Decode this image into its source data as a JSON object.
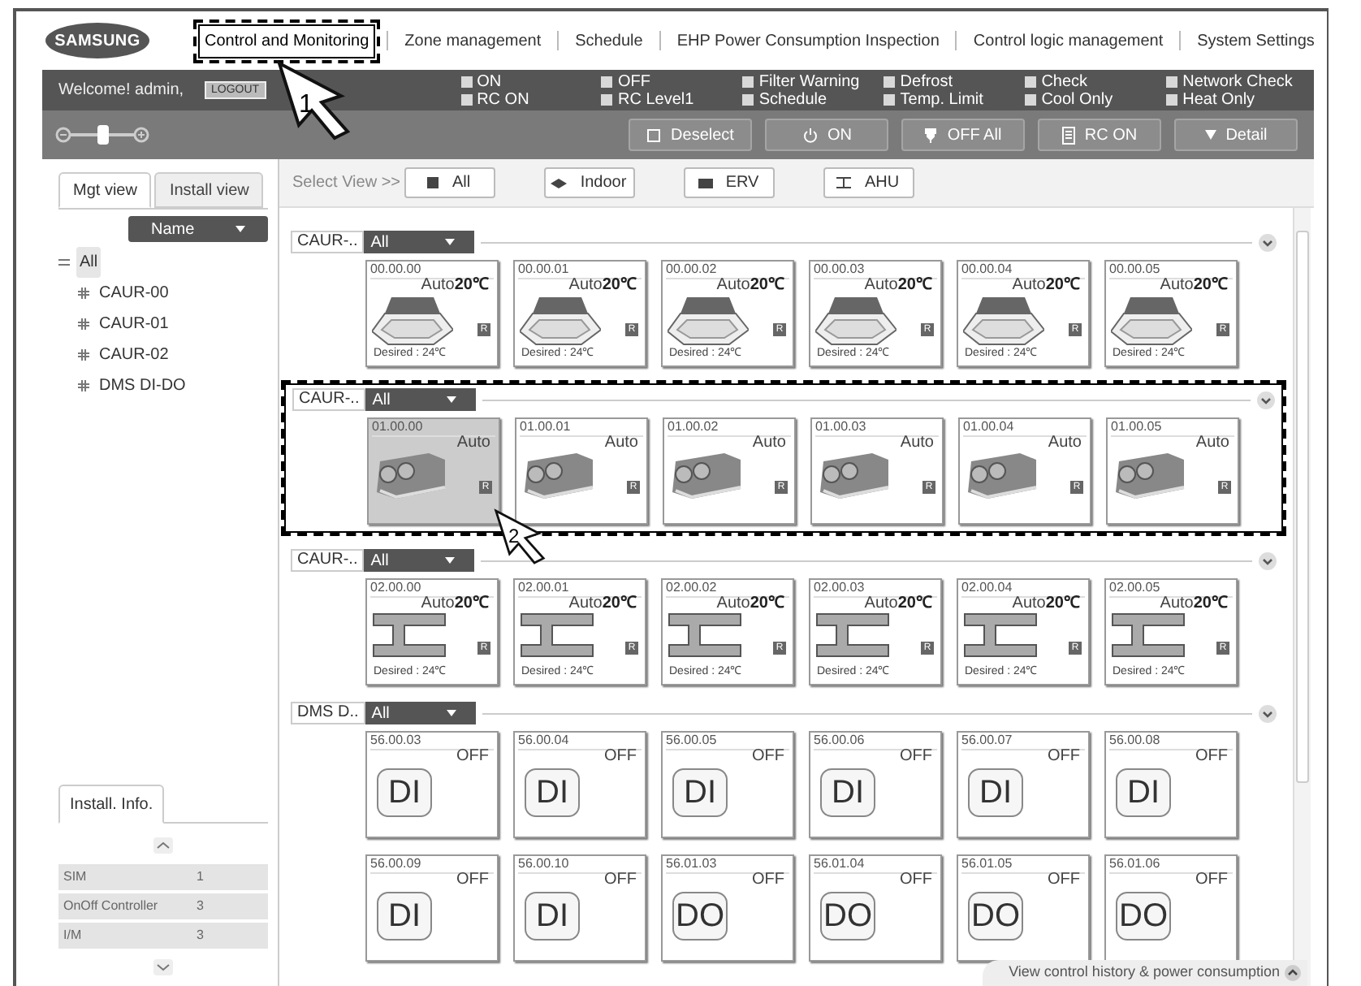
{
  "logo": "SAMSUNG",
  "nav": [
    {
      "label": "Control and Monitoring",
      "selected": true,
      "highlighted": true,
      "callout": "1"
    },
    {
      "label": "Zone management",
      "selected": false,
      "highlighted": false
    },
    {
      "label": "Schedule",
      "selected": false,
      "highlighted": false
    },
    {
      "label": "EHP Power Consumption Inspection",
      "selected": false,
      "highlighted": false
    },
    {
      "label": "Control logic management",
      "selected": false,
      "highlighted": false
    },
    {
      "label": "System Settings",
      "selected": false,
      "highlighted": false
    }
  ],
  "welcome": "Welcome! admin,",
  "logout": "LOGOUT",
  "legend": [
    {
      "label": "ON"
    },
    {
      "label": "OFF"
    },
    {
      "label": "Filter Warning"
    },
    {
      "label": "Defrost"
    },
    {
      "label": "Check"
    },
    {
      "label": "Network Check"
    },
    {
      "label": "RC ON"
    },
    {
      "label": "RC Level1"
    },
    {
      "label": "Schedule"
    },
    {
      "label": "Temp. Limit"
    },
    {
      "label": "Cool Only"
    },
    {
      "label": "Heat Only"
    }
  ],
  "zoom_slider": {
    "level": 0.5
  },
  "toolbar": [
    {
      "kind": "deselect",
      "label": "Deselect"
    },
    {
      "kind": "power",
      "label": "ON"
    },
    {
      "kind": "plug",
      "label": "OFF All"
    },
    {
      "kind": "remote",
      "label": "RC ON"
    },
    {
      "kind": "detail",
      "label": "Detail"
    }
  ],
  "left_tabs": [
    {
      "label": "Mgt view",
      "selected": true
    },
    {
      "label": "Install view",
      "selected": false
    }
  ],
  "sort": "Name",
  "tree": [
    {
      "label": "All",
      "expanded": true,
      "selected": true,
      "children": [
        {
          "label": "CAUR-00",
          "expanded": false,
          "selected": false
        },
        {
          "label": "CAUR-01",
          "expanded": false,
          "selected": false
        },
        {
          "label": "CAUR-02",
          "expanded": false,
          "selected": false
        },
        {
          "label": "DMS DI-DO",
          "expanded": false,
          "selected": false
        }
      ]
    }
  ],
  "install_info": {
    "tab": "Install. Info.",
    "rows": [
      {
        "name": "SIM",
        "count": "1"
      },
      {
        "name": "OnOff Controller",
        "count": "3"
      },
      {
        "name": "I/M",
        "count": "3"
      }
    ]
  },
  "view_label": "Select View >>",
  "view_filters": [
    {
      "kind": "all",
      "label": "All"
    },
    {
      "kind": "indoor",
      "label": "Indoor"
    },
    {
      "kind": "erv",
      "label": "ERV"
    },
    {
      "kind": "ahu",
      "label": "AHU"
    }
  ],
  "groups": [
    {
      "name": "CAUR-..",
      "filter": "All",
      "highlighted": false,
      "tiles": [
        {
          "kind": "cassette",
          "address": "00.00.00",
          "mode": "Auto",
          "temp": "20℃",
          "badge": "R",
          "desired": "Desired : 24℃",
          "selected": false
        },
        {
          "kind": "cassette",
          "address": "00.00.01",
          "mode": "Auto",
          "temp": "20℃",
          "badge": "R",
          "desired": "Desired : 24℃",
          "selected": false
        },
        {
          "kind": "cassette",
          "address": "00.00.02",
          "mode": "Auto",
          "temp": "20℃",
          "badge": "R",
          "desired": "Desired : 24℃",
          "selected": false
        },
        {
          "kind": "cassette",
          "address": "00.00.03",
          "mode": "Auto",
          "temp": "20℃",
          "badge": "R",
          "desired": "Desired : 24℃",
          "selected": false
        },
        {
          "kind": "cassette",
          "address": "00.00.04",
          "mode": "Auto",
          "temp": "20℃",
          "badge": "R",
          "desired": "Desired : 24℃",
          "selected": false
        },
        {
          "kind": "cassette",
          "address": "00.00.05",
          "mode": "Auto",
          "temp": "20℃",
          "badge": "R",
          "desired": "Desired : 24℃",
          "selected": false
        }
      ]
    },
    {
      "name": "CAUR-..",
      "filter": "All",
      "highlighted": true,
      "callout": "2",
      "tiles": [
        {
          "kind": "erv",
          "address": "01.00.00",
          "mode": "Auto",
          "badge": "R",
          "selected": true
        },
        {
          "kind": "erv",
          "address": "01.00.01",
          "mode": "Auto",
          "badge": "R",
          "selected": false
        },
        {
          "kind": "erv",
          "address": "01.00.02",
          "mode": "Auto",
          "badge": "R",
          "selected": false
        },
        {
          "kind": "erv",
          "address": "01.00.03",
          "mode": "Auto",
          "badge": "R",
          "selected": false
        },
        {
          "kind": "erv",
          "address": "01.00.04",
          "mode": "Auto",
          "badge": "R",
          "selected": false
        },
        {
          "kind": "erv",
          "address": "01.00.05",
          "mode": "Auto",
          "badge": "R",
          "selected": false
        }
      ]
    },
    {
      "name": "CAUR-..",
      "filter": "All",
      "highlighted": false,
      "tiles": [
        {
          "kind": "ahu",
          "address": "02.00.00",
          "mode": "Auto",
          "temp": "20℃",
          "badge": "R",
          "desired": "Desired : 24℃",
          "selected": false
        },
        {
          "kind": "ahu",
          "address": "02.00.01",
          "mode": "Auto",
          "temp": "20℃",
          "badge": "R",
          "desired": "Desired : 24℃",
          "selected": false
        },
        {
          "kind": "ahu",
          "address": "02.00.02",
          "mode": "Auto",
          "temp": "20℃",
          "badge": "R",
          "desired": "Desired : 24℃",
          "selected": false
        },
        {
          "kind": "ahu",
          "address": "02.00.03",
          "mode": "Auto",
          "temp": "20℃",
          "badge": "R",
          "desired": "Desired : 24℃",
          "selected": false
        },
        {
          "kind": "ahu",
          "address": "02.00.04",
          "mode": "Auto",
          "temp": "20℃",
          "badge": "R",
          "desired": "Desired : 24℃",
          "selected": false
        },
        {
          "kind": "ahu",
          "address": "02.00.05",
          "mode": "Auto",
          "temp": "20℃",
          "badge": "R",
          "desired": "Desired : 24℃",
          "selected": false
        }
      ]
    },
    {
      "name": "DMS D..",
      "filter": "All",
      "highlighted": false,
      "tiles": [
        {
          "kind": "io",
          "address": "56.00.03",
          "mode": "OFF",
          "label": "DI",
          "selected": false
        },
        {
          "kind": "io",
          "address": "56.00.04",
          "mode": "OFF",
          "label": "DI",
          "selected": false
        },
        {
          "kind": "io",
          "address": "56.00.05",
          "mode": "OFF",
          "label": "DI",
          "selected": false
        },
        {
          "kind": "io",
          "address": "56.00.06",
          "mode": "OFF",
          "label": "DI",
          "selected": false
        },
        {
          "kind": "io",
          "address": "56.00.07",
          "mode": "OFF",
          "label": "DI",
          "selected": false
        },
        {
          "kind": "io",
          "address": "56.00.08",
          "mode": "OFF",
          "label": "DI",
          "selected": false
        },
        {
          "kind": "io",
          "address": "56.00.09",
          "mode": "OFF",
          "label": "DI",
          "selected": false
        },
        {
          "kind": "io",
          "address": "56.00.10",
          "mode": "OFF",
          "label": "DI",
          "selected": false
        },
        {
          "kind": "io",
          "address": "56.01.03",
          "mode": "OFF",
          "label": "DO",
          "selected": false
        },
        {
          "kind": "io",
          "address": "56.01.04",
          "mode": "OFF",
          "label": "DO",
          "selected": false
        },
        {
          "kind": "io",
          "address": "56.01.05",
          "mode": "OFF",
          "label": "DO",
          "selected": false
        },
        {
          "kind": "io",
          "address": "56.01.06",
          "mode": "OFF",
          "label": "DO",
          "selected": false
        }
      ]
    }
  ],
  "footer": "View control history & power consumption"
}
